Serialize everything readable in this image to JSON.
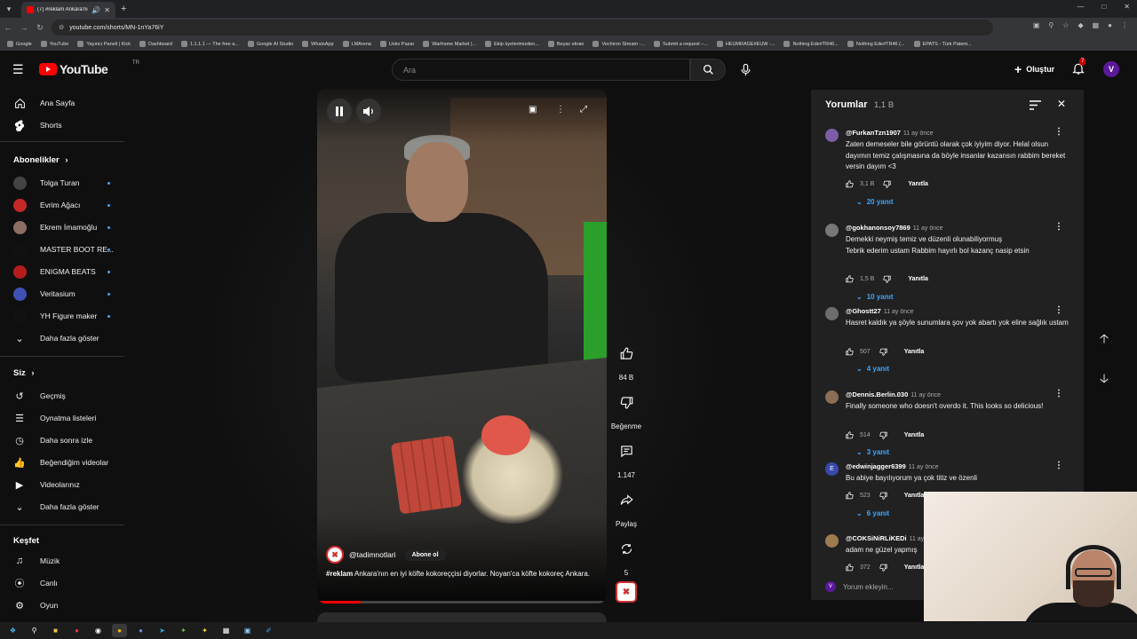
{
  "browser": {
    "tab_title": "(7) #reklam Ankara'nın en i...",
    "url": "youtube.com/shorts/MN-1nYa76iY",
    "bookmarks": [
      "Google",
      "YouTube",
      "Yayıncı Paneli | Kick",
      "Dashboard",
      "1.1.1.1 — The free a...",
      "Google AI Studio",
      "WhatsApp",
      "LMArena",
      "Usko Pazar",
      "Warframe Market |...",
      "Ekip üyelerimizden...",
      "Beyaz ekran",
      "Vechiron Stream -...",
      "Submit a request –...",
      "HEUMRAGE#EUW -...",
      "Nothing Ede#TR46...",
      "Nothing Ede#TR46 (...",
      "EPATS - Türk Patent..."
    ]
  },
  "header": {
    "logo_text": "YouTube",
    "logo_country": "TR",
    "search_placeholder": "Ara",
    "create_label": "Oluştur",
    "notification_count": "7",
    "avatar_letter": "V"
  },
  "sidebar": {
    "main": [
      {
        "label": "Ana Sayfa",
        "icon": "home-icon"
      },
      {
        "label": "Shorts",
        "icon": "shorts-icon"
      }
    ],
    "subscriptions_title": "Abonelikler",
    "subscriptions": [
      {
        "label": "Tolga Turan",
        "color": "#444"
      },
      {
        "label": "Evrim Ağacı",
        "color": "#c62828"
      },
      {
        "label": "Ekrem İmamoğlu",
        "color": "#8d6e63"
      },
      {
        "label": "MASTER BOOT RE...",
        "color": "#111"
      },
      {
        "label": "ENIGMA BEATS",
        "color": "#b71c1c"
      },
      {
        "label": "Veritasium",
        "color": "#3f51b5"
      },
      {
        "label": "YH Figure maker",
        "color": "#111"
      }
    ],
    "show_more": "Daha fazla göster",
    "you_title": "Siz",
    "you": [
      {
        "label": "Geçmiş",
        "icon": "history-icon"
      },
      {
        "label": "Oynatma listeleri",
        "icon": "playlist-icon"
      },
      {
        "label": "Daha sonra izle",
        "icon": "clock-icon"
      },
      {
        "label": "Beğendiğim videolar",
        "icon": "thumbs-up-icon"
      },
      {
        "label": "Videolarınız",
        "icon": "video-icon"
      }
    ],
    "show_more_2": "Daha fazla göster",
    "explore_title": "Keşfet",
    "explore": [
      {
        "label": "Müzik",
        "icon": "music-icon"
      },
      {
        "label": "Canlı",
        "icon": "live-icon"
      },
      {
        "label": "Oyun",
        "icon": "gaming-icon"
      }
    ]
  },
  "short": {
    "channel": "@tadimnotlari",
    "subscribe_label": "Abone ol",
    "caption_tag": "#reklam",
    "caption_text": " Ankara'nın en iyi köfte kokoreççisi diyorlar. Noyan'ca  köfte kokoreç Ankara.",
    "progress": 0.15
  },
  "actions": {
    "likes": "84 B",
    "dislike": "Beğenme",
    "comments": "1.147",
    "share": "Paylaş",
    "remix": "5"
  },
  "comments": {
    "title": "Yorumlar",
    "count": "1,1 B",
    "add_placeholder": "Yorum ekleyin...",
    "items": [
      {
        "author": "@FurkanTzn1907",
        "time": "11 ay önce",
        "text": "Zaten demeseler bile görüntü olarak çok iyiyim diyor. Helal olsun dayımın temiz çalışmasına da böyle insanlar kazansın rabbim bereket versin dayım <3",
        "likes": "3,1 B",
        "reply": "Yanıtla",
        "replies": "20 yanıt",
        "avatar_color": "#7b5ea7"
      },
      {
        "author": "@gokhanonsoy7869",
        "time": "11 ay önce",
        "text": "Demekki neymiş temiz ve düzenli olunabiliyormuş\nTebrik ederim ustam Rabbim hayırlı bol kazanç nasip etsin",
        "likes": "1,5 B",
        "reply": "Yanıtla",
        "replies": "10 yanıt",
        "avatar_color": "#777"
      },
      {
        "author": "@Ghostt27",
        "time": "11 ay önce",
        "text": "Hasret kaldık ya şöyle sunumlara şov yok abartı yok eline sağlık ustam",
        "likes": "507",
        "reply": "Yanıtla",
        "replies": "4 yanıt",
        "avatar_color": "#6d6d6d"
      },
      {
        "author": "@Dennis.Berlin.030",
        "time": "11 ay önce",
        "text": "Finally someone who doesn't overdo it. This looks so delicious!",
        "likes": "514",
        "reply": "Yanıtla",
        "replies": "3 yanıt",
        "avatar_color": "#8a6e55"
      },
      {
        "author": "@edwinjagger6399",
        "time": "11 ay önce",
        "text": "Bu abiye bayılıyorum ya çok titiz ve özenli",
        "likes": "523",
        "reply": "Yanıtla",
        "replies": "6 yanıt",
        "avatar_color": "#3949ab",
        "avatar_letter": "E"
      },
      {
        "author": "@COKSiNiRLiKEDi",
        "time": "11 ay",
        "text": "adam ne güzel yapmış",
        "likes": "372",
        "reply": "Yanıtla",
        "replies": "",
        "avatar_color": "#9e7b4f"
      }
    ]
  }
}
